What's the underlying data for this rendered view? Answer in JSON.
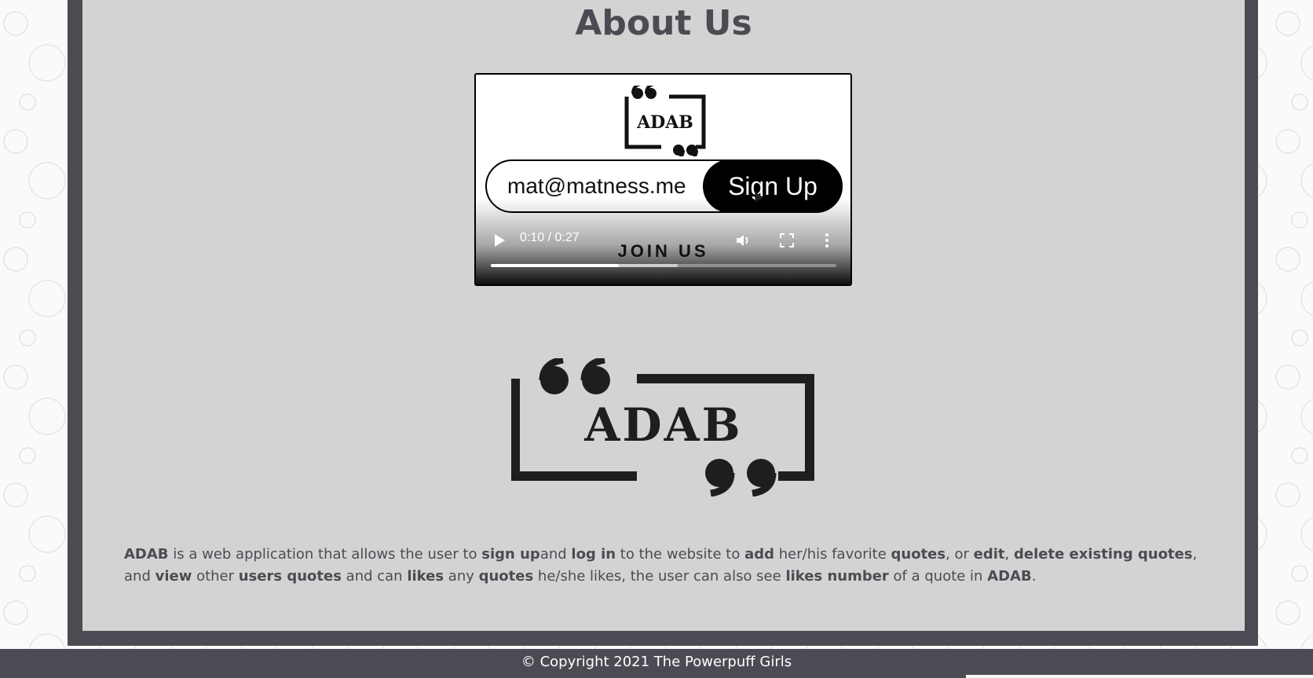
{
  "page": {
    "title": "About Us"
  },
  "video": {
    "logo_text": "ADAB",
    "email": "mat@matness.me",
    "signup_label": "Sign Up",
    "caption": "JOIN US",
    "time": "0:10 / 0:27",
    "progress": 0.37,
    "buffered": 0.54
  },
  "logo": {
    "text": "ADAB"
  },
  "description": [
    {
      "text": "ADAB",
      "bold": true
    },
    {
      "text": " is a web application that allows the user to ",
      "bold": false
    },
    {
      "text": "sign up",
      "bold": true
    },
    {
      "text": "and ",
      "bold": false
    },
    {
      "text": "log in",
      "bold": true
    },
    {
      "text": " to the website to ",
      "bold": false
    },
    {
      "text": "add",
      "bold": true
    },
    {
      "text": " her/his favorite ",
      "bold": false
    },
    {
      "text": "quotes",
      "bold": true
    },
    {
      "text": ", or ",
      "bold": false
    },
    {
      "text": "edit",
      "bold": true
    },
    {
      "text": ", ",
      "bold": false
    },
    {
      "text": "delete existing quotes",
      "bold": true
    },
    {
      "text": ", and ",
      "bold": false
    },
    {
      "text": "view",
      "bold": true
    },
    {
      "text": " other ",
      "bold": false
    },
    {
      "text": "users quotes",
      "bold": true
    },
    {
      "text": " and can ",
      "bold": false
    },
    {
      "text": "likes",
      "bold": true
    },
    {
      "text": " any ",
      "bold": false
    },
    {
      "text": "quotes",
      "bold": true
    },
    {
      "text": " he/she likes, the user can also see ",
      "bold": false
    },
    {
      "text": "likes number",
      "bold": true
    },
    {
      "text": " of a quote in ",
      "bold": false
    },
    {
      "text": "ADAB",
      "bold": true
    },
    {
      "text": ".",
      "bold": false
    }
  ],
  "footer": {
    "copyright": "© Copyright 2021 The Powerpuff Girls"
  },
  "colors": {
    "frame": "#4b4c53",
    "panel": "#d3d3d3",
    "text": "#4b4c53"
  }
}
